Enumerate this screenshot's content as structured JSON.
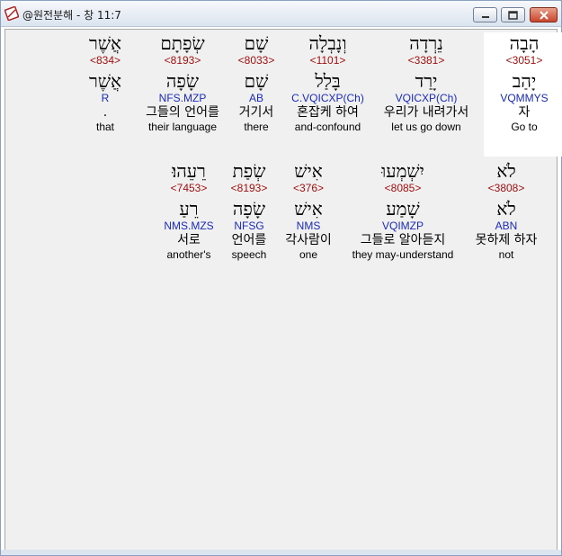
{
  "window": {
    "title": "@원전분해 - 창 11:7",
    "icon": "bible-app-icon"
  },
  "rows": [
    {
      "words": [
        {
          "heb": "הָבָה",
          "strong": "<3051>",
          "lemma": "יָהַב",
          "morph": "VQMMYS",
          "kor": "자",
          "eng": "Go to",
          "highlight": true
        },
        {
          "heb": "נֵרְדָה",
          "strong": "<3381>",
          "lemma": "יָרַד",
          "morph": "VQICXP(Ch)",
          "kor": "우리가 내려가서",
          "eng": "let us go down"
        },
        {
          "heb": "וְנָבְלָה",
          "strong": "<1101>",
          "lemma": "בָּלַל",
          "morph": "C.VQICXP(Ch)",
          "kor": "혼잡케 하여",
          "eng": "and-confound"
        },
        {
          "heb": "שָׁם",
          "strong": "<8033>",
          "lemma": "שָׁם",
          "morph": "AB",
          "kor": "거기서",
          "eng": "there"
        },
        {
          "heb": "שְׂפָתָם",
          "strong": "<8193>",
          "lemma": "שָׂפָה",
          "morph": "NFS.MZP",
          "kor": "그들의 언어를",
          "eng": "their language"
        },
        {
          "heb": "אֲשֶׁר",
          "strong": "<834>",
          "lemma": "אֲשֶׁר",
          "morph": "R",
          "kor": ".",
          "eng": "that"
        }
      ]
    },
    {
      "words": [
        {
          "heb": "לֹא",
          "strong": "<3808>",
          "lemma": "לֹא",
          "morph": "ABN",
          "kor": "못하제 하자",
          "eng": "not"
        },
        {
          "heb": "יִשְׁמְעוּ",
          "strong": "<8085>",
          "lemma": "שָׁמַע",
          "morph": "VQIMZP",
          "kor": "그들로 알아듣지",
          "eng": "they may-understand"
        },
        {
          "heb": "אִישׁ",
          "strong": "<376>",
          "lemma": "אִישׁ",
          "morph": "NMS",
          "kor": "각사람이",
          "eng": "one"
        },
        {
          "heb": "שְׂפַת",
          "strong": "<8193>",
          "lemma": "שָׂפָה",
          "morph": "NFSG",
          "kor": "언어를",
          "eng": "speech"
        },
        {
          "heb": "רֵעֵהוּ׃",
          "strong": "<7453>",
          "lemma": "רֵעַ",
          "morph": "NMS.MZS",
          "kor": "서로",
          "eng": "another's"
        }
      ]
    }
  ]
}
